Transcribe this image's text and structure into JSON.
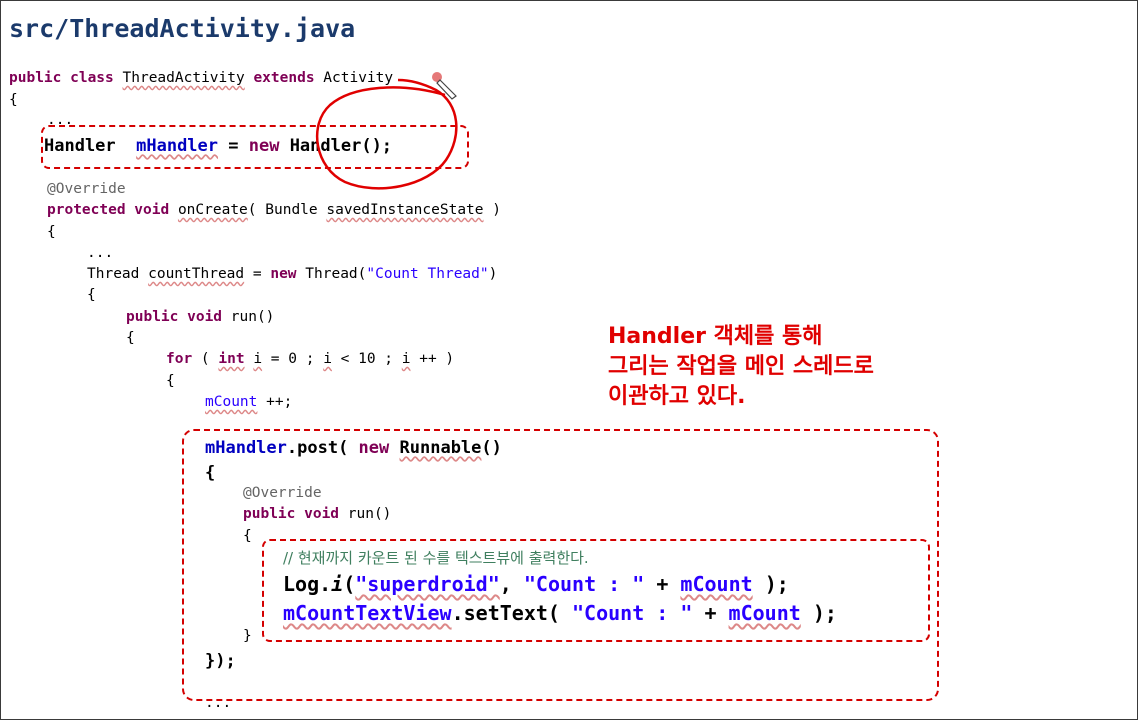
{
  "title": "src/ThreadActivity.java",
  "code": {
    "l1": {
      "kw1": "public class",
      "t1": " ",
      "cls": "ThreadActivity",
      "t2": " ",
      "kw2": "extends",
      "t3": " ",
      "parent": "Activity"
    },
    "l2": "{",
    "l3": "...",
    "l4": {
      "t1": "Handler  ",
      "fld": "mHandler",
      "t2": " = ",
      "kw": "new",
      "t3": " Handler();"
    },
    "l5": "@Override",
    "l6": {
      "kw": "protected void",
      "t1": " ",
      "m": "onCreate",
      "t2": "( Bundle ",
      "p": "savedInstanceState",
      "t3": " )"
    },
    "l7": "{",
    "l8": "...",
    "l9": {
      "t1": "Thread ",
      "v": "countThread",
      "t2": " = ",
      "kw": "new",
      "t3": " Thread(",
      "s": "\"Count Thread\"",
      "t4": ")"
    },
    "l10": "{",
    "l11": {
      "kw": "public void",
      "t1": " run()"
    },
    "l12": "{",
    "l13": {
      "kw1": "for",
      "t1": " ( ",
      "kw2": "int",
      "t2": " ",
      "i1": "i",
      "t3": " = 0 ; ",
      "i2": "i",
      "t4": " < 10 ; ",
      "i3": "i",
      "t5": " ++ )"
    },
    "l14": "{",
    "l15": {
      "fld": "mCount",
      "t1": " ++;"
    },
    "l16": {
      "fld": "mHandler",
      "t1": ".post( ",
      "kw": "new",
      "t2": " ",
      "r": "Runnable",
      "t3": "()"
    },
    "l17": "{",
    "l18": "@Override",
    "l19": {
      "kw": "public void",
      "t1": " run()"
    },
    "l20": "{",
    "l21": "// 현재까지 카운트 된 수를 텍스트뷰에 출력한다.",
    "l22": {
      "c": "Log",
      "t1": ".",
      "m": "i",
      "t2": "(",
      "s1": "\"superdroid\"",
      "t3": ", ",
      "s2": "\"Count : \"",
      "t4": " + ",
      "fld": "mCount",
      "t5": " );"
    },
    "l23": {
      "v": "mCountTextView",
      "t1": ".setText( ",
      "s": "\"Count : \"",
      "t2": " + ",
      "fld": "mCount",
      "t3": " );"
    },
    "l24": "}",
    "l25": "});",
    "l26": "..."
  },
  "note": [
    "Handler 객체를 통해",
    "그리는 작업을 메인 스레드로",
    "이관하고 있다."
  ],
  "colors": {
    "highlight": "#d40000",
    "title": "#1b3a6b",
    "note": "#e00000"
  }
}
